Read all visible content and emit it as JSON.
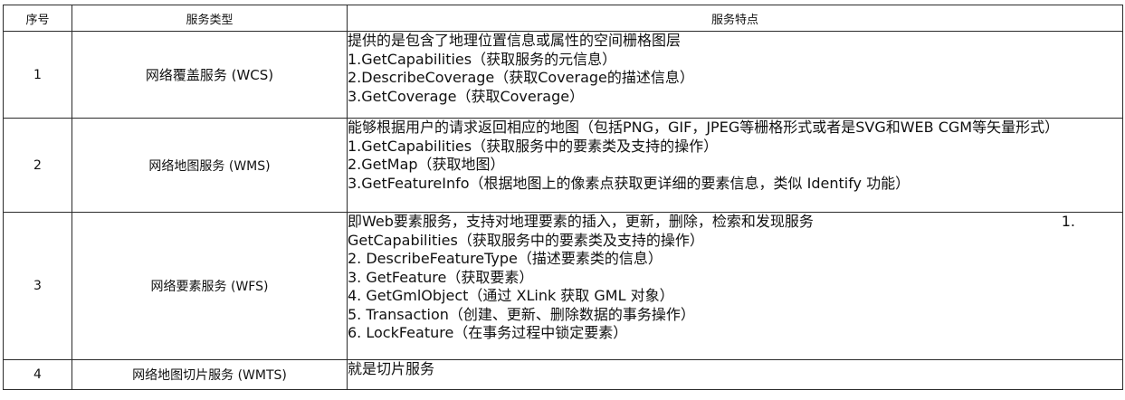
{
  "headers": {
    "index": "序号",
    "type": "服务类型",
    "features": "服务特点"
  },
  "rows": [
    {
      "index": "1",
      "type": "网络覆盖服务 (WCS)",
      "lines": [
        "提供的是包含了地理位置信息或属性的空间栅格图层",
        "1.GetCapabilities（获取服务的元信息）",
        "2.DescribeCoverage（获取Coverage的描述信息）",
        "3.GetCoverage（获取Coverage）"
      ]
    },
    {
      "index": "2",
      "type": "网络地图服务 (WMS)",
      "lines": [
        "能够根据用户的请求返回相应的地图（包括PNG，GIF，JPEG等栅格形式或者是SVG和WEB CGM等矢量形式）",
        "1.GetCapabilities（获取服务中的要素类及支持的操作）",
        "2.GetMap（获取地图）",
        "3.GetFeatureInfo（根据地图上的像素点获取更详细的要素信息，类似 Identify 功能）"
      ]
    },
    {
      "index": "3",
      "type": "网络要素服务 (WFS)",
      "first_line": "即Web要素服务，支持对地理要素的插入，更新，删除，检索和发现服务",
      "first_line_tail": "1.",
      "lines": [
        "GetCapabilities（获取服务中的要素类及支持的操作）",
        "2.  DescribeFeatureType（描述要素类的信息）",
        "3.  GetFeature（获取要素）",
        "4.  GetGmlObject（通过 XLink 获取 GML 对象）",
        "5.  Transaction（创建、更新、删除数据的事务操作）",
        "6.  LockFeature（在事务过程中锁定要素）"
      ]
    },
    {
      "index": "4",
      "type": "网络地图切片服务 (WMTS)",
      "lines": [
        "就是切片服务"
      ]
    }
  ]
}
